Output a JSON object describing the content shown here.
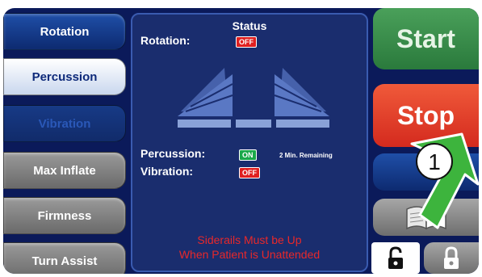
{
  "left_menu": {
    "rotation": "Rotation",
    "percussion": "Percussion",
    "vibration": "Vibration",
    "max_inflate": "Max Inflate",
    "firmness": "Firmness",
    "turn_assist": "Turn Assist"
  },
  "status": {
    "title": "Status",
    "rotation_label": "Rotation:",
    "rotation_state": "OFF",
    "percussion_label": "Percussion:",
    "percussion_state": "ON",
    "percussion_remaining": "2 Min. Remaining",
    "vibration_label": "Vibration:",
    "vibration_state": "OFF",
    "warning_line1": "Siderails Must be Up",
    "warning_line2": "When Patient is Unattended"
  },
  "controls": {
    "start": "Start",
    "stop": "Stop"
  },
  "callout": {
    "number": "1"
  },
  "colors": {
    "screen_bg": "#0b1a5a",
    "start_green": "#2a7a3c",
    "stop_red": "#d42a1e",
    "warning_red": "#e8282a",
    "on_green": "#1aa84a",
    "off_red": "#e02020",
    "callout_green": "#3db43d"
  },
  "icons": {
    "bed_graphic": "bed-sections-icon",
    "manual": "manual-book-icon",
    "unlock": "unlocked-padlock-icon",
    "lock": "locked-padlock-icon",
    "callout_arrow": "callout-arrow-icon"
  }
}
